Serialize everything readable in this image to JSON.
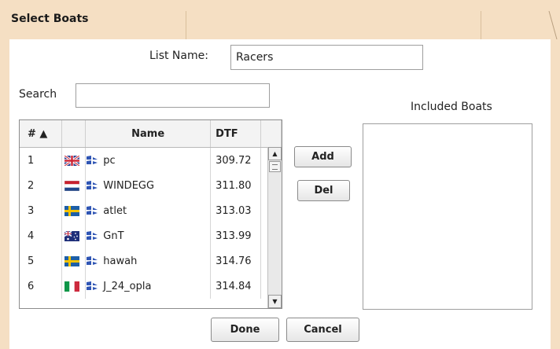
{
  "dialog": {
    "title": "Select Boats"
  },
  "list_name": {
    "label": "List Name:",
    "value": "Racers"
  },
  "search": {
    "label": "Search",
    "value": "",
    "placeholder": ""
  },
  "included": {
    "label": "Included Boats",
    "items": []
  },
  "table": {
    "headers": {
      "num": "# ▲",
      "flag": "",
      "name": "Name",
      "dtf": "DTF"
    },
    "sort": {
      "column": "#",
      "direction": "ascending"
    },
    "rows": [
      {
        "num": "1",
        "flag_icon": "uk-flag-icon",
        "boat_icon": "sail-icon",
        "name": "pc",
        "dtf": "309.72"
      },
      {
        "num": "2",
        "flag_icon": "netherlands-flag-icon",
        "boat_icon": "sail-icon",
        "name": "WINDEGG",
        "dtf": "311.80"
      },
      {
        "num": "3",
        "flag_icon": "sweden-flag-icon",
        "boat_icon": "sail-icon",
        "name": "atlet",
        "dtf": "313.03"
      },
      {
        "num": "4",
        "flag_icon": "australia-flag-icon",
        "boat_icon": "sail-icon",
        "name": "GnT",
        "dtf": "313.99"
      },
      {
        "num": "5",
        "flag_icon": "sweden-flag-icon",
        "boat_icon": "sail-icon",
        "name": "hawah",
        "dtf": "314.76"
      },
      {
        "num": "6",
        "flag_icon": "italy-flag-icon",
        "boat_icon": "sail-icon",
        "name": "J_24_opla",
        "dtf": "314.84"
      }
    ]
  },
  "buttons": {
    "add": "Add",
    "del": "Del",
    "done": "Done",
    "cancel": "Cancel"
  },
  "colors": {
    "frame": "#f5dfc3",
    "boat_icon": "#2f55b4",
    "border": "#8c8c8c"
  }
}
